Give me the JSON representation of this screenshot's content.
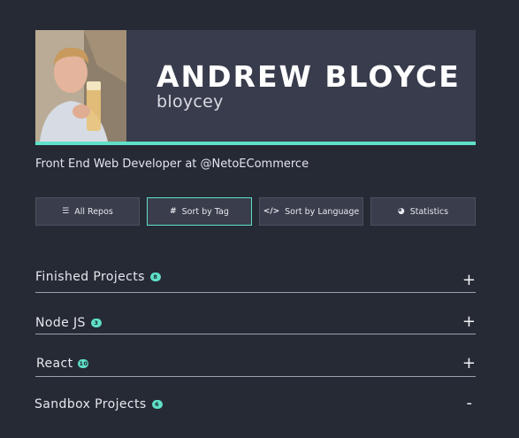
{
  "profile": {
    "name": "ANDREW BLOYCE",
    "username": "bloycey",
    "bio": "Front End Web Developer at @NetoECommerce"
  },
  "colors": {
    "background": "#262a35",
    "card": "#383c4c",
    "accent": "#5fe0c9"
  },
  "nav": {
    "buttons": [
      {
        "label": "All Repos",
        "icon": "list-icon",
        "glyph": "☰",
        "active": false
      },
      {
        "label": "Sort by Tag",
        "icon": "hashtag-icon",
        "glyph": "#",
        "active": true
      },
      {
        "label": "Sort by Language",
        "icon": "code-icon",
        "glyph": "</>",
        "active": false
      },
      {
        "label": "Statistics",
        "icon": "pie-chart-icon",
        "glyph": "◕",
        "active": false
      }
    ]
  },
  "sections": [
    {
      "title": "Finished Projects",
      "count": "8",
      "toggle": "+"
    },
    {
      "title": "Node JS",
      "count": "3",
      "toggle": "+"
    },
    {
      "title": "React",
      "count": "10",
      "toggle": "+"
    },
    {
      "title": "Sandbox Projects",
      "count": "6",
      "toggle": "-"
    }
  ]
}
